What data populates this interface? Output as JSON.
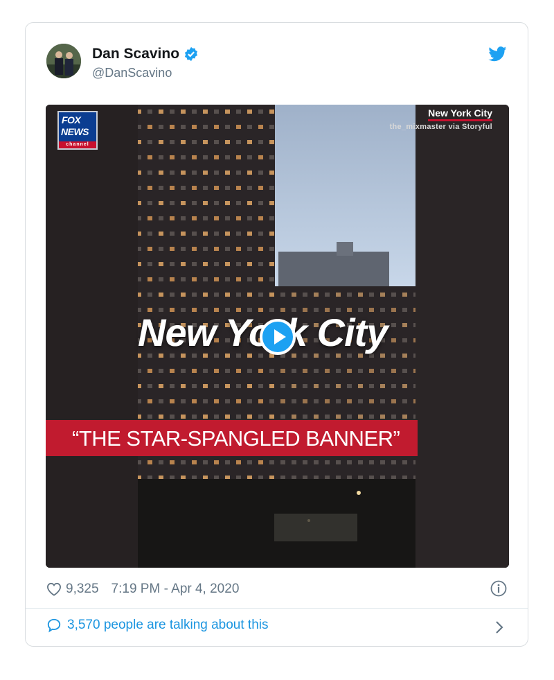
{
  "tweet": {
    "display_name": "Dan Scavino",
    "handle": "@DanScavino",
    "verified": true,
    "brand_color": "#1da1f2"
  },
  "media": {
    "network_logo_line1": "FOX",
    "network_logo_line2": "NEWS",
    "network_logo_line3": "channel",
    "location_label": "New York City",
    "credit": "the_mixmaster via Storyful",
    "title": "New York City",
    "banner": "“THE STAR-SPANGLED BANNER”",
    "icon": "play-icon"
  },
  "meta": {
    "like_count": "9,325",
    "timestamp": "7:19 PM - Apr 4, 2020",
    "icons": [
      "heart-icon",
      "info-icon"
    ]
  },
  "footer": {
    "talking": "3,570 people are talking about this",
    "icons": [
      "comment-bubble-icon",
      "chevron-right-icon"
    ]
  }
}
